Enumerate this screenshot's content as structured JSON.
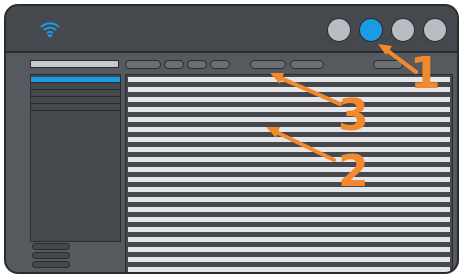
{
  "topbar": {
    "wifi_icon": "wifi-icon",
    "buttons": [
      {
        "name": "circle-button-1",
        "active": false
      },
      {
        "name": "circle-button-2",
        "active": true
      },
      {
        "name": "circle-button-3",
        "active": false
      },
      {
        "name": "circle-button-4",
        "active": false
      }
    ]
  },
  "callouts": [
    {
      "label": "1"
    },
    {
      "label": "3"
    },
    {
      "label": "2"
    }
  ],
  "colors": {
    "accent": "#1a9be6",
    "callout": "#f28a2d",
    "frame": "#56595e",
    "panel": "#45484d",
    "row": "#e3e5e8"
  }
}
